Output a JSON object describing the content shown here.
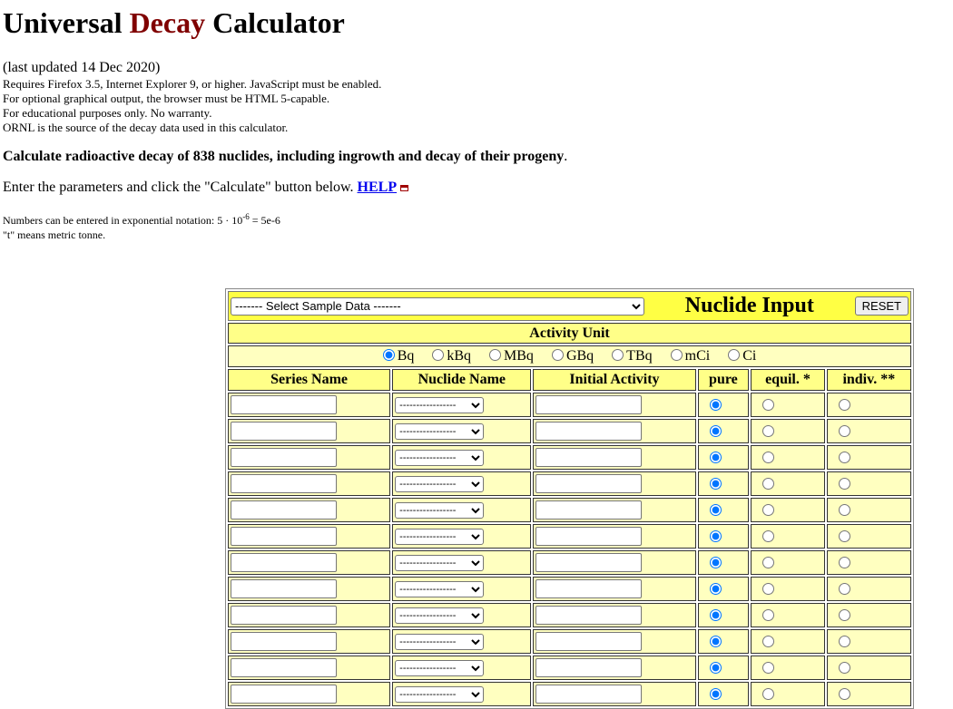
{
  "header": {
    "title_part1": "Universal ",
    "title_accent": "Decay",
    "title_part2": " Calculator",
    "accent_color": "#800000",
    "last_updated": "(last updated 14 Dec 2020)",
    "notes": [
      "Requires Firefox 3.5, Internet Explorer 9, or higher. JavaScript must be enabled.",
      "For optional graphical output, the browser must be HTML 5-capable.",
      "For educational purposes only. No warranty.",
      "ORNL is the source of the decay data used in this calculator."
    ]
  },
  "intro": {
    "lead_bold": "Calculate radioactive decay of 838 nuclides, including ingrowth and decay of their progeny",
    "lead_tail": ".",
    "enter_text": "Enter the parameters and click the \"Calculate\" button below. ",
    "help_link": "HELP",
    "help_icon": "popup-window-icon",
    "expo_prefix": "Numbers can be entered in exponential notation: 5 · 10",
    "expo_sup": "-6",
    "expo_suffix": " = 5e-6",
    "tonne_note": "\"t\" means metric tonne."
  },
  "form": {
    "sample_select_value": "------- Select Sample Data -------",
    "title": "Nuclide Input",
    "reset_label": "RESET",
    "activity_unit_label": "Activity Unit",
    "units": [
      {
        "label": "Bq",
        "checked": true
      },
      {
        "label": "kBq",
        "checked": false
      },
      {
        "label": "MBq",
        "checked": false
      },
      {
        "label": "GBq",
        "checked": false
      },
      {
        "label": "TBq",
        "checked": false
      },
      {
        "label": "mCi",
        "checked": false
      },
      {
        "label": "Ci",
        "checked": false
      }
    ],
    "columns": [
      "Series Name",
      "Nuclide Name",
      "Initial Activity",
      "pure",
      "equil. *",
      "indiv. **"
    ],
    "nuclide_select_placeholder": "-----------------",
    "rows": [
      {
        "series": "",
        "nuclide": "-----------------",
        "activity": "",
        "mode": "pure"
      },
      {
        "series": "",
        "nuclide": "-----------------",
        "activity": "",
        "mode": "pure"
      },
      {
        "series": "",
        "nuclide": "-----------------",
        "activity": "",
        "mode": "pure"
      },
      {
        "series": "",
        "nuclide": "-----------------",
        "activity": "",
        "mode": "pure"
      },
      {
        "series": "",
        "nuclide": "-----------------",
        "activity": "",
        "mode": "pure"
      },
      {
        "series": "",
        "nuclide": "-----------------",
        "activity": "",
        "mode": "pure"
      },
      {
        "series": "",
        "nuclide": "-----------------",
        "activity": "",
        "mode": "pure"
      },
      {
        "series": "",
        "nuclide": "-----------------",
        "activity": "",
        "mode": "pure"
      },
      {
        "series": "",
        "nuclide": "-----------------",
        "activity": "",
        "mode": "pure"
      },
      {
        "series": "",
        "nuclide": "-----------------",
        "activity": "",
        "mode": "pure"
      },
      {
        "series": "",
        "nuclide": "-----------------",
        "activity": "",
        "mode": "pure"
      },
      {
        "series": "",
        "nuclide": "-----------------",
        "activity": "",
        "mode": "pure"
      }
    ]
  }
}
